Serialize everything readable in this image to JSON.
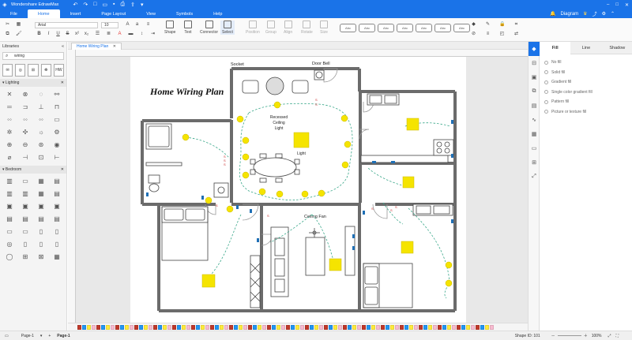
{
  "app": {
    "title": "Wondershare EdrawMax",
    "window_controls": [
      "–",
      "□",
      "✕"
    ]
  },
  "menu": {
    "tabs": [
      "File",
      "Home",
      "Insert",
      "Page Layout",
      "View",
      "Symbols",
      "Help"
    ],
    "active": "Home",
    "right_label": "Diagram"
  },
  "toolbar": {
    "font": "Arial",
    "size": "10",
    "tools": [
      {
        "label": "Shape",
        "enabled": true
      },
      {
        "label": "Text",
        "enabled": true
      },
      {
        "label": "Connector",
        "enabled": true
      },
      {
        "label": "Select",
        "enabled": true
      }
    ],
    "disabled_tools": [
      "Position",
      "Group",
      "Align",
      "Rotate",
      "Size"
    ],
    "style_box_label": "Abc"
  },
  "sidebar": {
    "title": "Libraries",
    "search_value": "wiring",
    "thumb_labels": [
      "HW"
    ],
    "sections": [
      "Lighting",
      "Bedroom"
    ]
  },
  "document": {
    "tab": "Home Wiring Plan"
  },
  "plan": {
    "title": "Home Wiring Plan",
    "labels": {
      "socket": "Socket",
      "door_bell": "Door Bell",
      "recessed_light": "Recessed\nCeiling\nLight",
      "light": "Light",
      "ceiling_fan": "Ceiling Fan"
    }
  },
  "status": {
    "page_select": "Page-1",
    "page_tab": "Page-1",
    "shape_id": "Shape ID: 101",
    "zoom": "100%"
  },
  "right_panel": {
    "tabs": [
      "Fill",
      "Line",
      "Shadow"
    ],
    "active_tab": "Fill",
    "fill_options": [
      "No fill",
      "Solid fill",
      "Gradient fill",
      "Single color gradient fill",
      "Pattern fill",
      "Picture or texture fill"
    ]
  },
  "colors": {
    "accent": "#1a73e8",
    "wall": "#6b6b6b",
    "light_fixture": "#f5e400",
    "wire": "#3aa88a"
  }
}
